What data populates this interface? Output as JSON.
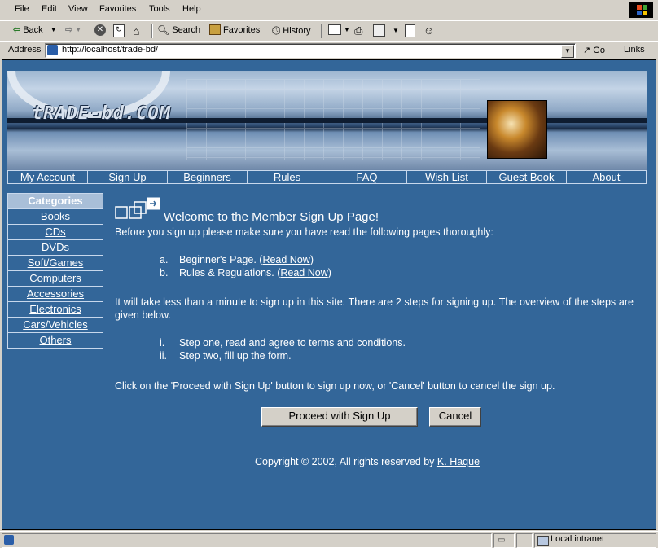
{
  "menu": [
    "File",
    "Edit",
    "View",
    "Favorites",
    "Tools",
    "Help"
  ],
  "toolbar": {
    "back": "Back",
    "search": "Search",
    "favorites": "Favorites",
    "history": "History"
  },
  "address": {
    "label": "Address",
    "url": "http://localhost/trade-bd/",
    "go": "Go",
    "links": "Links"
  },
  "banner": {
    "logo": "tRADE-bd.COM"
  },
  "nav": [
    "My Account",
    "Sign Up",
    "Beginners",
    "Rules",
    "FAQ",
    "Wish List",
    "Guest Book",
    "About"
  ],
  "categories": {
    "title": "Categories",
    "items": [
      "Books",
      "CDs",
      "DVDs",
      "Soft/Games",
      "Computers",
      "Accessories",
      "Electronics",
      "Cars/Vehicles",
      "Others"
    ]
  },
  "content": {
    "welcome": "Welcome to the Member Sign Up Page!",
    "intro": "Before you sign up please make sure you have read the following pages thoroughly:",
    "pages": [
      {
        "num": "a.",
        "text": "Beginner's Page. (",
        "link": "Read Now",
        "after": ")"
      },
      {
        "num": "b.",
        "text": "Rules & Regulations. (",
        "link": "Read Now",
        "after": ")"
      }
    ],
    "overview": "It will take less than a minute to sign up in this site. There are 2 steps for signing up. The overview of the steps are given below.",
    "steps": [
      {
        "num": "i.",
        "text": "Step one, read and agree to terms and conditions."
      },
      {
        "num": "ii.",
        "text": "Step two, fill up the form."
      }
    ],
    "instruction": "Click on the 'Proceed with Sign Up' button to sign up now, or 'Cancel' button to cancel the sign up.",
    "proceed_button": "Proceed with Sign Up",
    "cancel_button": "Cancel",
    "copyright_text": "Copyright © 2002, All rights reserved by ",
    "copyright_author": "K. Haque"
  },
  "status": {
    "zone": "Local intranet"
  },
  "colors": {
    "page_bg": "#336699",
    "chrome": "#d4d0c8",
    "category_header": "#a9bfd8"
  }
}
